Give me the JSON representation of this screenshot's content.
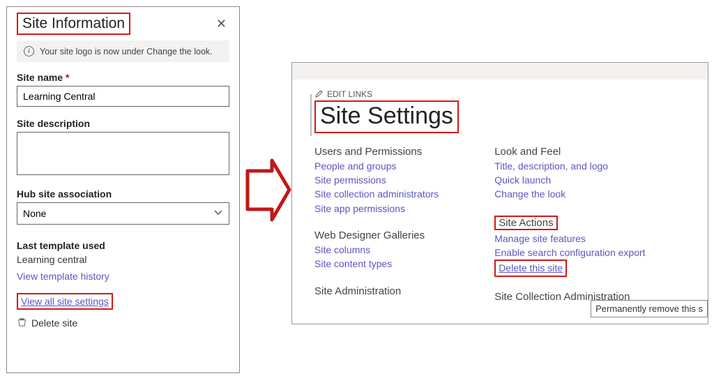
{
  "panel": {
    "title": "Site Information",
    "info_message": "Your site logo is now under Change the look.",
    "site_name_label": "Site name",
    "site_name_value": "Learning Central",
    "site_desc_label": "Site description",
    "site_desc_value": "",
    "hub_label": "Hub site association",
    "hub_value": "None",
    "last_template_label": "Last template used",
    "last_template_value": "Learning central",
    "view_template_history": "View template history",
    "view_all_settings": "View all site settings",
    "delete_site": "Delete site"
  },
  "settings": {
    "edit_links": "EDIT LINKS",
    "title": "Site Settings",
    "col1": {
      "users_perm": {
        "heading": "Users and Permissions",
        "links": [
          "People and groups",
          "Site permissions",
          "Site collection administrators",
          "Site app permissions"
        ]
      },
      "web_designer": {
        "heading": "Web Designer Galleries",
        "links": [
          "Site columns",
          "Site content types"
        ]
      },
      "site_admin": {
        "heading": "Site Administration"
      }
    },
    "col2": {
      "look_feel": {
        "heading": "Look and Feel",
        "links": [
          "Title, description, and logo",
          "Quick launch",
          "Change the look"
        ]
      },
      "site_actions": {
        "heading": "Site Actions",
        "links": [
          "Manage site features",
          "Enable search configuration export",
          "Delete this site"
        ]
      },
      "site_coll_admin": {
        "heading": "Site Collection Administration"
      }
    },
    "tooltip": "Permanently remove this s"
  }
}
